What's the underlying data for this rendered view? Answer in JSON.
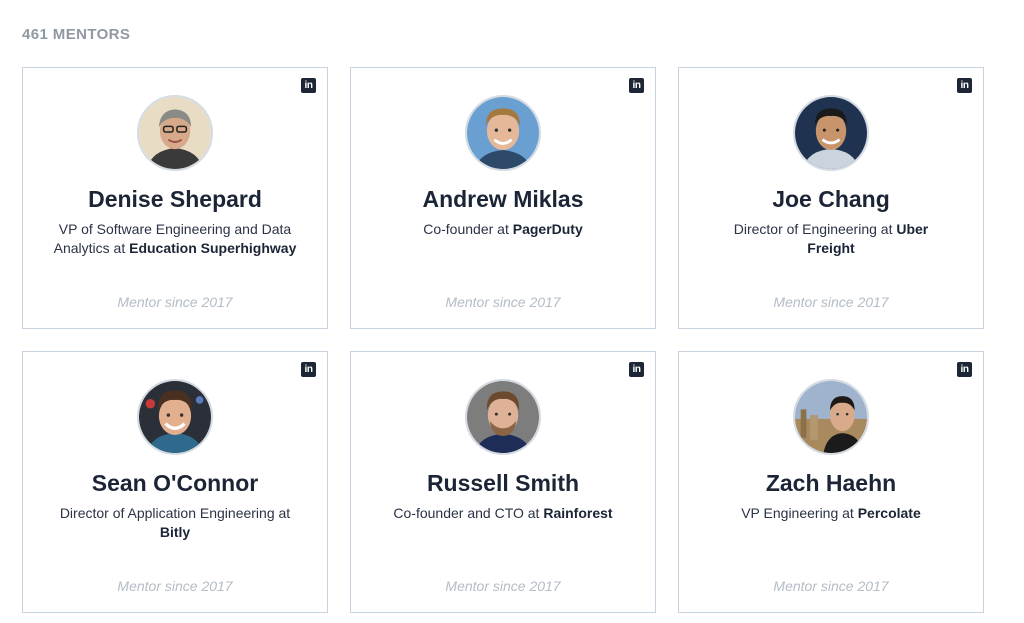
{
  "header": {
    "mentor_count": "461 MENTORS"
  },
  "linkedin_icon_text": "in",
  "mentors": [
    {
      "name": "Denise Shepard",
      "role_prefix": "VP of Software Engineering and Data Analytics at ",
      "company": "Education Superhighway",
      "since": "Mentor since 2017",
      "avatar_icon": "woman-with-glasses-avatar"
    },
    {
      "name": "Andrew Miklas",
      "role_prefix": "Co-founder at ",
      "company": "PagerDuty",
      "since": "Mentor since 2017",
      "avatar_icon": "man-blond-avatar"
    },
    {
      "name": "Joe Chang",
      "role_prefix": "Director of Engineering at ",
      "company": "Uber Freight",
      "since": "Mentor since 2017",
      "avatar_icon": "man-dark-background-avatar"
    },
    {
      "name": "Sean O'Connor",
      "role_prefix": "Director of Application Engineering at ",
      "company": "Bitly",
      "since": "Mentor since 2017",
      "avatar_icon": "man-smiling-avatar"
    },
    {
      "name": "Russell Smith",
      "role_prefix": "Co-founder and CTO at ",
      "company": "Rainforest",
      "since": "Mentor since 2017",
      "avatar_icon": "man-beard-avatar"
    },
    {
      "name": "Zach Haehn",
      "role_prefix": "VP Engineering at ",
      "company": "Percolate",
      "since": "Mentor since 2017",
      "avatar_icon": "man-city-background-avatar"
    }
  ],
  "colors": {
    "card_border": "#c8d2de",
    "name_text": "#1c2536",
    "muted_text": "#8f98a3",
    "since_text": "#b4bcc6",
    "linkedin_icon_bg": "#1d2634"
  }
}
